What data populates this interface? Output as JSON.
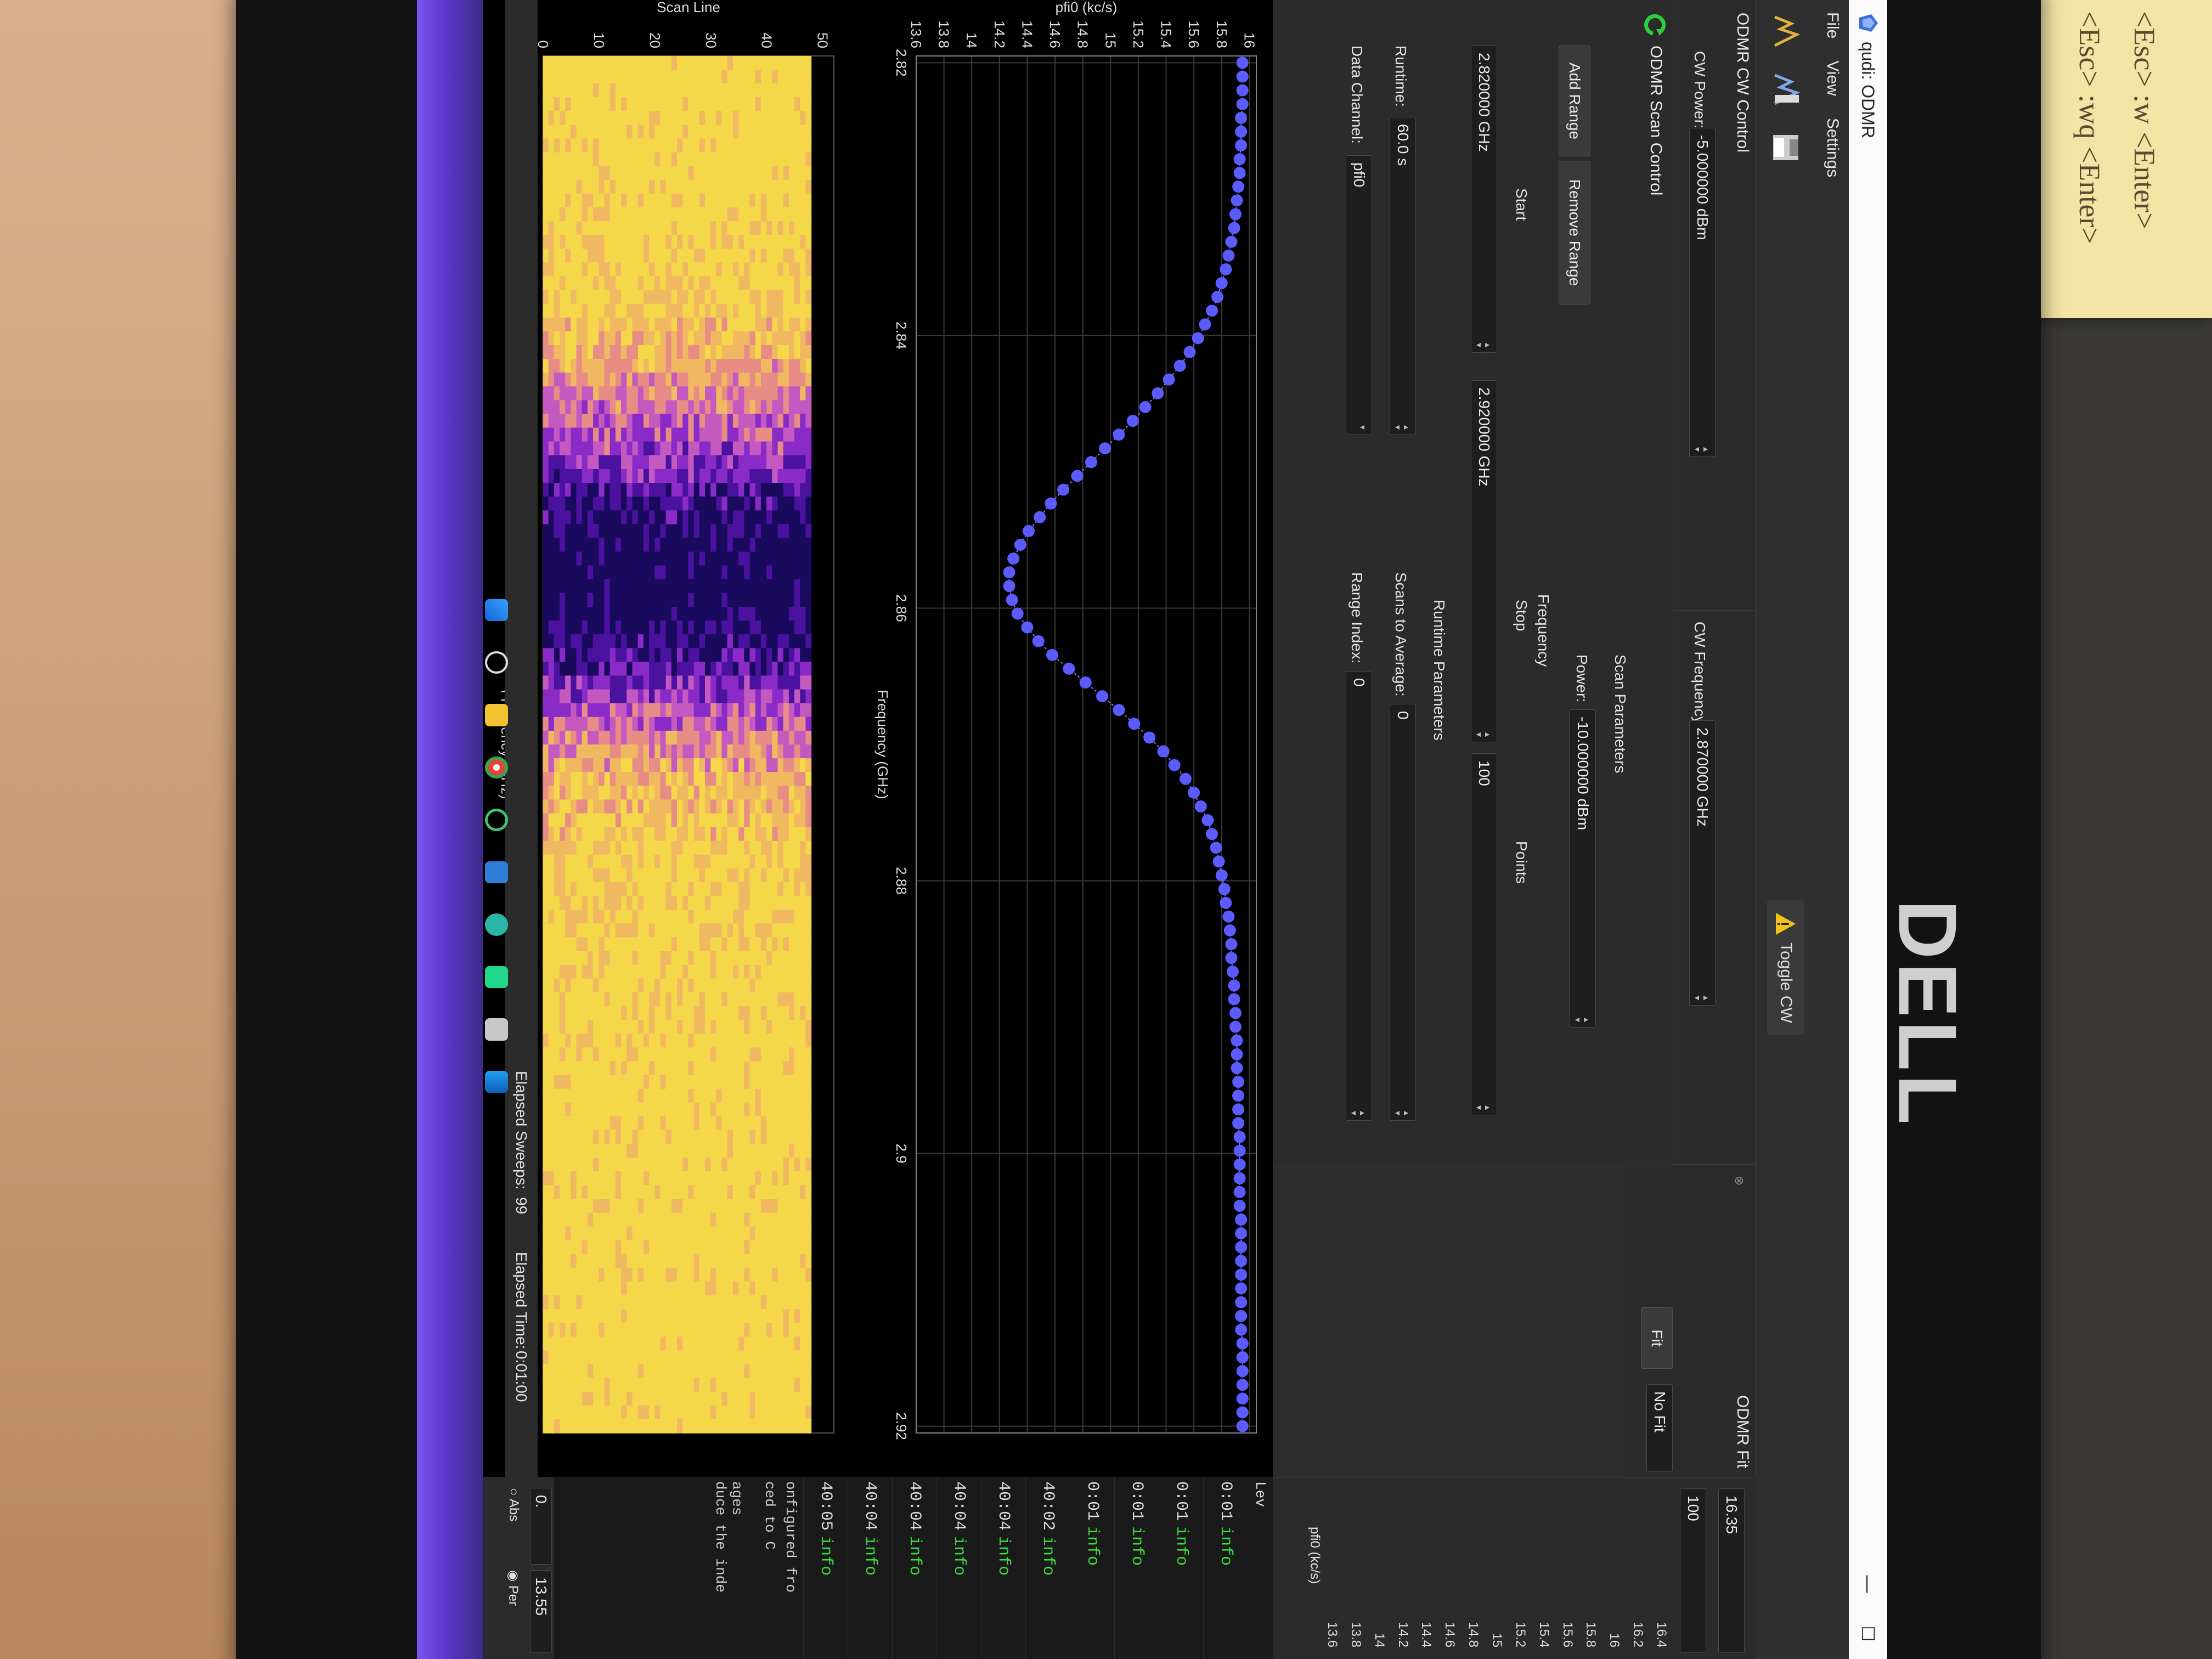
{
  "window": {
    "title": "qudi: ODMR",
    "menu": [
      "File",
      "View",
      "Settings"
    ],
    "toolbar": {
      "toggle_cw": "Toggle CW"
    }
  },
  "cw_control": {
    "panel_title": "ODMR CW Control",
    "cw_power_label": "CW Power:",
    "cw_power_value": "-5.000000 dBm",
    "cw_frequency_label": "CW Frequency:",
    "cw_frequency_value": "2.870000 GHz"
  },
  "fit": {
    "panel_title": "ODMR Fit",
    "fit_button": "Fit",
    "fit_function": "No Fit"
  },
  "scan_control": {
    "panel_title": "ODMR Scan Control",
    "add_range": "Add Range",
    "remove_range": "Remove Range",
    "scan_parameters_label": "Scan Parameters",
    "power_label": "Power:",
    "power_value": "-10.000000 dBm",
    "frequency_label": "Frequency",
    "start_label": "Start",
    "stop_label": "Stop",
    "points_label": "Points",
    "start_value": "2.820000 GHz",
    "stop_value": "2.920000 GHz",
    "points_value": "100",
    "runtime_parameters_label": "Runtime Parameters",
    "runtime_label": "Runtime:",
    "runtime_value": "60.0 s",
    "scans_to_average_label": "Scans to Average:",
    "scans_to_average_value": "0",
    "data_channel_label": "Data Channel:",
    "data_channel_value": "pfi0",
    "range_index_label": "Range Index:",
    "range_index_value": "0"
  },
  "status": {
    "elapsed_sweeps_label": "Elapsed Sweeps:",
    "elapsed_sweeps_value": "99",
    "elapsed_time_label": "Elapsed Time:",
    "elapsed_time_value": "0:01:00"
  },
  "colorbar": {
    "max_value": "16.35",
    "percentile_value": "100",
    "ticks": [
      "16.4",
      "16.2",
      "16",
      "15.8",
      "15.6",
      "15.4",
      "15.2",
      "15",
      "14.8",
      "14.6",
      "14.4",
      "14.2",
      "14",
      "13.8",
      "13.6"
    ],
    "unit_label": "pfi0 (kc/s)",
    "min_percentile": "0.",
    "min_value": "13.55",
    "mode_absolute": "Abs",
    "mode_percentile": "Per"
  },
  "log": {
    "header": "Lev",
    "rows": [
      "0:01 info",
      "0:01 info",
      "0:01 info",
      "0:01 info",
      "40:02 info",
      "40:04 info",
      "40:04 info",
      "40:04 info",
      "40:04 info",
      "40:05 info"
    ],
    "footer_lines": [
      "onfigured fro",
      "ced to C"
    ],
    "bottom_lines": [
      "ages",
      "duce the inde"
    ]
  },
  "chart_data": [
    {
      "type": "scatter",
      "xlabel": "Frequency (GHz)",
      "ylabel": "pfi0 (kc/s)",
      "x_ticks": [
        "2.82",
        "2.84",
        "2.86",
        "2.88",
        "2.9",
        "2.92"
      ],
      "y_ticks": [
        "16",
        "15.8",
        "15.6",
        "15.4",
        "15.2",
        "15",
        "14.8",
        "14.6",
        "14.4",
        "14.2",
        "14",
        "13.8",
        "13.6"
      ],
      "xlim": [
        2.8195,
        2.9205
      ],
      "ylim": [
        13.6,
        16.05
      ],
      "marker_color": "#5b5bff",
      "series": [
        {
          "x_start": 2.82,
          "x_stop": 2.92,
          "points": 100,
          "y": [
            15.95,
            15.95,
            15.95,
            15.95,
            15.94,
            15.94,
            15.94,
            15.93,
            15.93,
            15.92,
            15.91,
            15.9,
            15.89,
            15.87,
            15.85,
            15.83,
            15.8,
            15.77,
            15.73,
            15.68,
            15.63,
            15.57,
            15.5,
            15.42,
            15.34,
            15.25,
            15.16,
            15.06,
            14.96,
            14.86,
            14.76,
            14.66,
            14.57,
            14.49,
            14.41,
            14.35,
            14.3,
            14.27,
            14.27,
            14.29,
            14.33,
            14.4,
            14.48,
            14.58,
            14.7,
            14.82,
            14.94,
            15.06,
            15.17,
            15.28,
            15.38,
            15.46,
            15.54,
            15.6,
            15.65,
            15.7,
            15.73,
            15.76,
            15.78,
            15.8,
            15.82,
            15.83,
            15.85,
            15.86,
            15.87,
            15.87,
            15.88,
            15.89,
            15.89,
            15.9,
            15.9,
            15.91,
            15.91,
            15.91,
            15.92,
            15.92,
            15.92,
            15.92,
            15.93,
            15.93,
            15.93,
            15.93,
            15.93,
            15.93,
            15.94,
            15.94,
            15.94,
            15.94,
            15.94,
            15.94,
            15.94,
            15.94,
            15.94,
            15.95,
            15.95,
            15.95,
            15.95,
            15.95,
            15.95,
            15.95
          ]
        }
      ]
    },
    {
      "type": "heatmap",
      "xlabel": "Frequency (GHz)",
      "ylabel": "Scan Line",
      "x_ticks": [
        "2.82",
        "2.84",
        "2.86",
        "2.88",
        "2.9",
        "2.92"
      ],
      "y_ticks": [
        "50",
        "40",
        "30",
        "20",
        "10",
        "0"
      ],
      "xlim": [
        2.8195,
        2.9205
      ],
      "ylim": [
        0,
        52
      ],
      "colormap": [
        "#1a0a5e",
        "#4b12a0",
        "#8a2bc8",
        "#c45ac0",
        "#e88c86",
        "#f0b860",
        "#f5d84a"
      ],
      "dip_center": 2.855,
      "scan_lines": 52
    }
  ]
}
